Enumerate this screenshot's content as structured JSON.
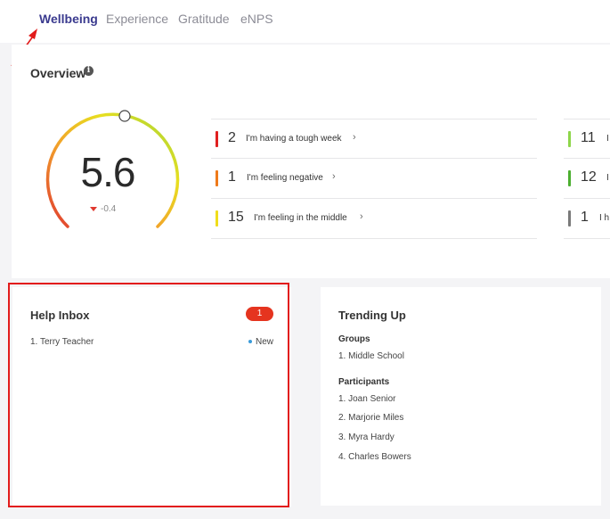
{
  "tabs": [
    {
      "label": "Wellbeing",
      "active": true
    },
    {
      "label": "Experience",
      "active": false
    },
    {
      "label": "Gratitude",
      "active": false
    },
    {
      "label": "eNPS",
      "active": false
    }
  ],
  "overview": {
    "title": "Overview",
    "info_icon": "info-icon",
    "score": "5.6",
    "delta": "-0.4",
    "gauge_level": 0.56,
    "rows_left": [
      {
        "count": "2",
        "label": "I'm having a tough week",
        "color": "#e02020"
      },
      {
        "count": "1",
        "label": "I'm feeling negative",
        "color": "#ef7a1a"
      },
      {
        "count": "15",
        "label": "I'm feeling in the middle",
        "color": "#f0dd1a"
      }
    ],
    "rows_right": [
      {
        "count": "11",
        "label": "I",
        "color": "#8ed64a"
      },
      {
        "count": "12",
        "label": "I",
        "color": "#4caf30"
      },
      {
        "count": "1",
        "label": "I h",
        "color": "#7a7a7a"
      }
    ]
  },
  "help_inbox": {
    "title": "Help Inbox",
    "badge": "1",
    "items": [
      {
        "label": "1. Terry Teacher",
        "status": "New"
      }
    ]
  },
  "trending_up": {
    "title": "Trending Up",
    "groups_label": "Groups",
    "groups": [
      "1. Middle School"
    ],
    "participants_label": "Participants",
    "participants": [
      "1. Joan Senior",
      "2. Marjorie Miles",
      "3. Myra Hardy",
      "4. Charles Bowers"
    ]
  }
}
